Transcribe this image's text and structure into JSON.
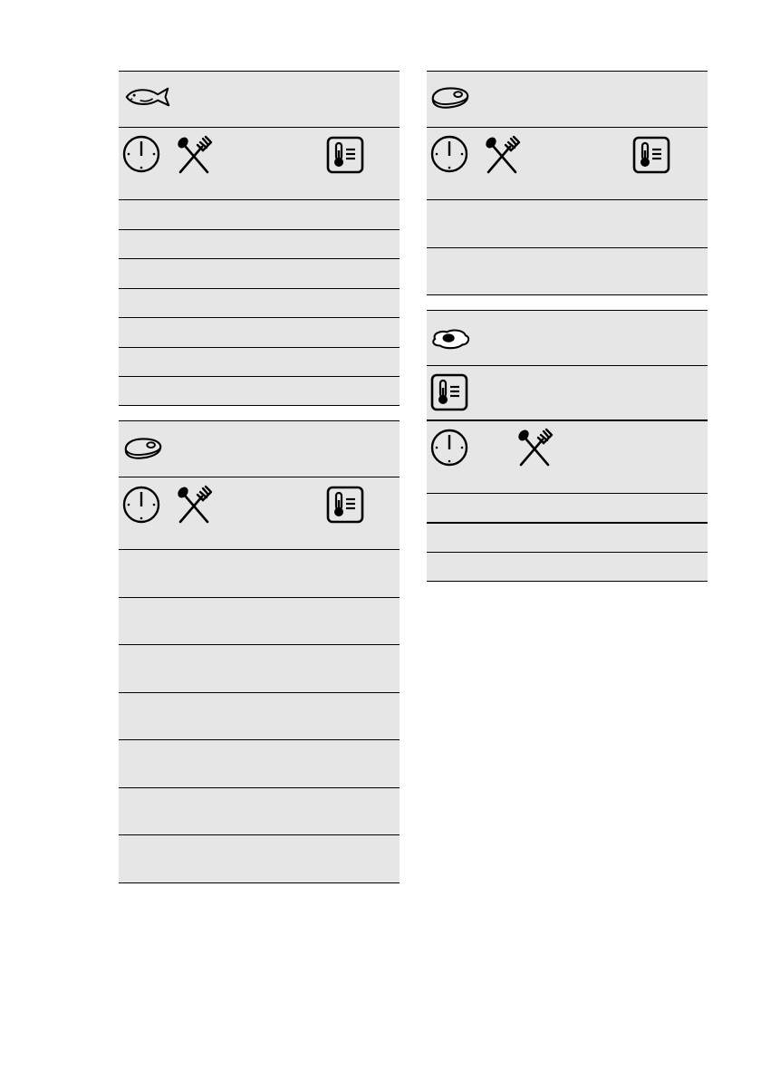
{
  "icons": {
    "fish": "fish-icon",
    "meat": "steak-icon",
    "egg": "fried-egg-icon",
    "clock": "clock-icon",
    "cutlery": "spoon-fork-icon",
    "thermometer": "food-sensor-thermometer-icon"
  },
  "colors": {
    "table_fill": "#e6e6e6",
    "rule": "#000000"
  },
  "tables": [
    {
      "id": "fish",
      "category_icon": "fish-icon",
      "column_icons": [
        "clock-icon",
        "spoon-fork-icon",
        "food-sensor-thermometer-icon"
      ],
      "data_rows": 7
    },
    {
      "id": "meat-left",
      "category_icon": "steak-icon",
      "column_icons": [
        "clock-icon",
        "spoon-fork-icon",
        "food-sensor-thermometer-icon"
      ],
      "data_rows": 7
    },
    {
      "id": "meat-right",
      "category_icon": "steak-icon",
      "column_icons": [
        "clock-icon",
        "spoon-fork-icon",
        "food-sensor-thermometer-icon"
      ],
      "data_rows": 2
    },
    {
      "id": "egg",
      "category_icon": "fried-egg-icon",
      "column_icons": [
        "food-sensor-thermometer-icon",
        "clock-icon",
        "spoon-fork-icon"
      ],
      "data_rows": 3
    }
  ]
}
